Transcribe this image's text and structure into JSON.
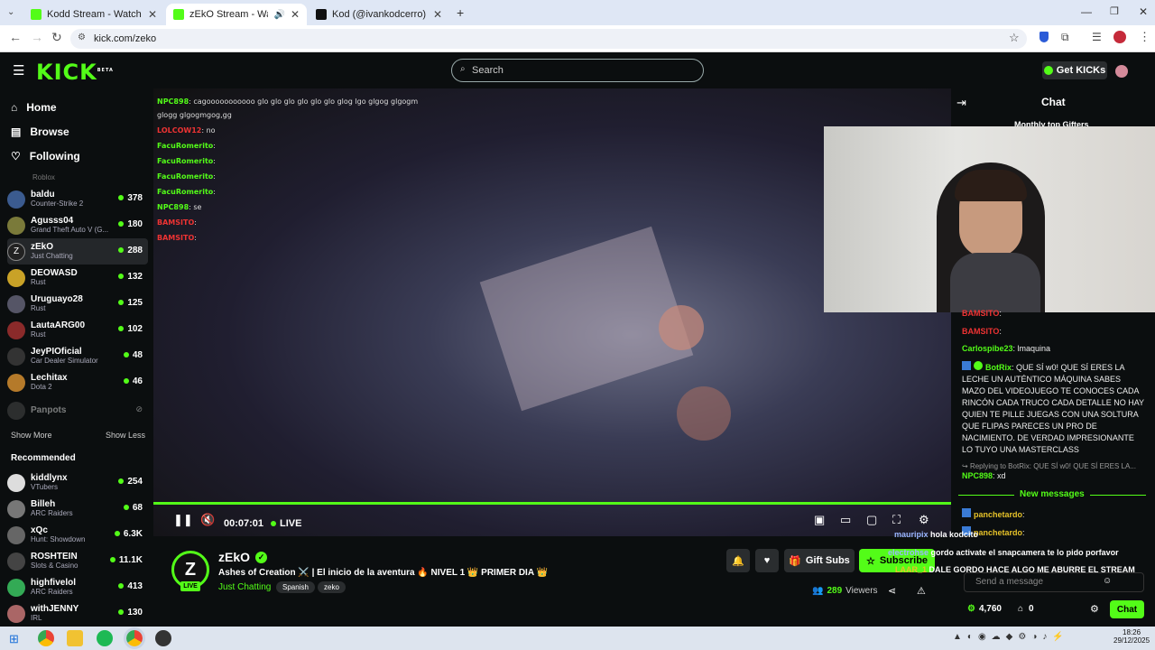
{
  "browser": {
    "tabs": [
      {
        "title": "Kodd Stream - Watch Live on K"
      },
      {
        "title": "zEkO Stream - Watch Live o"
      },
      {
        "title": "Kod (@ivankodcerro) | TikTok"
      }
    ],
    "url": "kick.com/zeko"
  },
  "header": {
    "logo": "KICK",
    "logo_sup": "BETA",
    "search_placeholder": "Search",
    "get_kicks": "Get KICKs"
  },
  "nav": {
    "home": "Home",
    "browse": "Browse",
    "following": "Following"
  },
  "following": {
    "top_partial": "Roblox",
    "channels": [
      {
        "name": "baldu",
        "category": "Counter-Strike 2",
        "viewers": "378",
        "color": "#3b5b8f"
      },
      {
        "name": "Agusss04",
        "category": "Grand Theft Auto V (G...",
        "viewers": "180",
        "color": "#7a7a3a"
      },
      {
        "name": "zEkO",
        "category": "Just Chatting",
        "viewers": "288",
        "color": "#222"
      },
      {
        "name": "DEOWASD",
        "category": "Rust",
        "viewers": "132",
        "color": "#c9a227"
      },
      {
        "name": "Uruguayo28",
        "category": "Rust",
        "viewers": "125",
        "color": "#556"
      },
      {
        "name": "LautaARG00",
        "category": "Rust",
        "viewers": "102",
        "color": "#8a2a2a"
      },
      {
        "name": "JeyPIOficial",
        "category": "Car Dealer Simulator",
        "viewers": "48",
        "color": "#333"
      },
      {
        "name": "Lechitax",
        "category": "Dota 2",
        "viewers": "46",
        "color": "#b57a2a"
      }
    ],
    "offline": "Panpots",
    "show_more": "Show More",
    "show_less": "Show Less"
  },
  "recommended": {
    "title": "Recommended",
    "channels": [
      {
        "name": "kiddlynx",
        "category": "VTubers",
        "viewers": "254",
        "color": "#ddd"
      },
      {
        "name": "Billeh",
        "category": "ARC Raiders",
        "viewers": "68",
        "color": "#777"
      },
      {
        "name": "xQc",
        "category": "Hunt: Showdown",
        "viewers": "6.3K",
        "color": "#666"
      },
      {
        "name": "ROSHTEIN",
        "category": "Slots & Casino",
        "viewers": "11.1K",
        "color": "#444"
      },
      {
        "name": "highfivelol",
        "category": "ARC Raiders",
        "viewers": "413",
        "color": "#3a5"
      },
      {
        "name": "withJENNY",
        "category": "IRL",
        "viewers": "130",
        "color": "#a66"
      }
    ]
  },
  "overlay_chat": [
    {
      "user": "NPC898",
      "text": ": cagooooooooooo glo glo glo glo glo glo glog lgo glgog glgogm"
    },
    {
      "user": "",
      "text": "glogg glgogmgog,gg"
    },
    {
      "user": "LOLCOW12",
      "text": ": no"
    },
    {
      "user": "FacuRomerito",
      "text": ":"
    },
    {
      "user": "FacuRomerito",
      "text": ":"
    },
    {
      "user": "FacuRomerito",
      "text": ":"
    },
    {
      "user": "FacuRomerito",
      "text": ":"
    },
    {
      "user": "NPC898",
      "text": ": se"
    },
    {
      "user": "BAMSITO",
      "text": ":"
    },
    {
      "user": "BAMSITO",
      "text": ":"
    }
  ],
  "player": {
    "time": "00:07:01",
    "live": "LIVE"
  },
  "stream": {
    "channel": "zEkO",
    "title": "Ashes of Creation ⚔️ | El inicio de la aventura 🔥 NIVEL 1 👑 PRIMER DIA 👑",
    "category": "Just Chatting",
    "tags": [
      "Spanish",
      "zeko"
    ],
    "viewers": "289",
    "viewers_label": "Viewers",
    "live_badge": "LIVE",
    "gift_subs": "Gift Subs",
    "subscribe": "Subscribe"
  },
  "chat": {
    "title": "Chat",
    "top_gifters": "Monthly top Gifters",
    "messages": [
      {
        "user": "BAMSITO",
        "text": ":",
        "color": "#e33"
      },
      {
        "user": "BAMSITO",
        "text": ":",
        "color": "#e33"
      },
      {
        "user": "Carlospibe23",
        "text": ": lmaquina",
        "color": "#53fc18"
      },
      {
        "user": "BotRix",
        "text": ": QUE SÍ w0! QUE SÍ ERES LA LECHE UN AUTÉNTICO MÁQUINA SABES MAZO DEL VIDEOJUEGO TE CONOCES CADA RINCÓN CADA TRUCO CADA DETALLE NO HAY QUIEN TE PILLE JUEGAS CON UNA SOLTURA QUE FLIPAS PARECES UN PRO DE NACIMIENTO. DE VERDAD IMPRESIONANTE LO TUYO UNA MASTERCLASS",
        "color": "#53fc18"
      }
    ],
    "reply_to": "Replying to BotRix: QUE SÍ w0! QUE SÍ ERES LA...",
    "reply": {
      "user": "NPC898",
      "text": ": xd"
    },
    "new_messages": "New messages",
    "recent": [
      {
        "user": "panchetardo",
        "text": ":"
      },
      {
        "user": "panchetardo",
        "text": ":"
      }
    ],
    "overlay_lines": [
      {
        "user": "mauripix",
        "text": "hola kodcito"
      },
      {
        "user": "electrohse",
        "text": "gordo activate el snapcamera te lo pido porfavor"
      },
      {
        "user": "LAAR_1",
        "text": "DALE GORDO HACE ALGO ME ABURRE EL STREAM"
      }
    ],
    "input_placeholder": "Send a message",
    "kicks": "4,760",
    "gifts": "0",
    "send": "Chat"
  },
  "taskbar": {
    "time": "18:26",
    "date": "29/12/2025"
  }
}
